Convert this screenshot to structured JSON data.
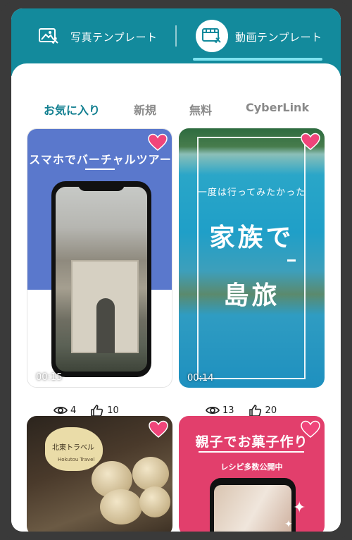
{
  "header": {
    "photo_tab_label": "写真テンプレート",
    "video_tab_label": "動画テンプレート",
    "photo_tab_icon": "photo-template-icon",
    "video_tab_icon": "video-template-icon",
    "accent_color": "#138a9c"
  },
  "categories": [
    {
      "label": "お気に入り",
      "active": true
    },
    {
      "label": "新規",
      "active": false
    },
    {
      "label": "無料",
      "active": false
    },
    {
      "label": "CyberLink",
      "active": false
    }
  ],
  "templates": [
    {
      "title": "スマホでバーチャルツアー",
      "duration": "00:15",
      "views": "4",
      "likes": "10",
      "favorited": true
    },
    {
      "small_text": "一度は行ってみたかった",
      "big_text_1": "家族で",
      "big_text_2": "島旅",
      "duration": "00:14",
      "views": "13",
      "likes": "20",
      "favorited": true
    },
    {
      "badge_title": "北東トラベル",
      "badge_sub": "Hokutou Travel",
      "favorited": true
    },
    {
      "title": "親子でお菓子作り",
      "subtitle": "レシピ多数公開中",
      "favorited": true
    }
  ],
  "colors": {
    "heart": "#f0457a",
    "active_category": "#127f90",
    "inactive_category": "#8a8a8a"
  }
}
